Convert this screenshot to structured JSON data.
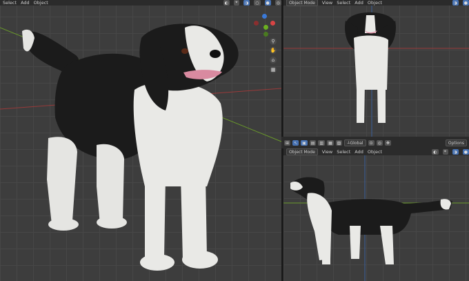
{
  "left_view": {
    "menus": [
      "Select",
      "Add",
      "Object"
    ]
  },
  "top_right_view": {
    "mode": "Object Mode",
    "menus": [
      "View",
      "Select",
      "Add",
      "Object"
    ]
  },
  "bottom_right_view": {
    "toolbar": {
      "orientation": "Global"
    },
    "mode": "Object Mode",
    "menus": [
      "View",
      "Select",
      "Add",
      "Object"
    ],
    "options_label": "Options"
  },
  "colors": {
    "viewport_bg": "#3d3d3d",
    "header_bg": "#2b2b2b",
    "x_axis": "#9a3a3a",
    "y_axis": "#6a9a2a",
    "z_axis": "#3a5e9a",
    "active_button": "#4772b3",
    "dog_black": "#1b1b1b",
    "dog_white": "#e9e9e6",
    "dog_tongue": "#d98aa0"
  },
  "icons": [
    "zoom-icon",
    "hand-pan-icon",
    "camera-icon",
    "grid-icon",
    "cursor-icon",
    "select-box-icon",
    "shading-solid-icon",
    "overlay-icon",
    "gizmo-icon"
  ]
}
